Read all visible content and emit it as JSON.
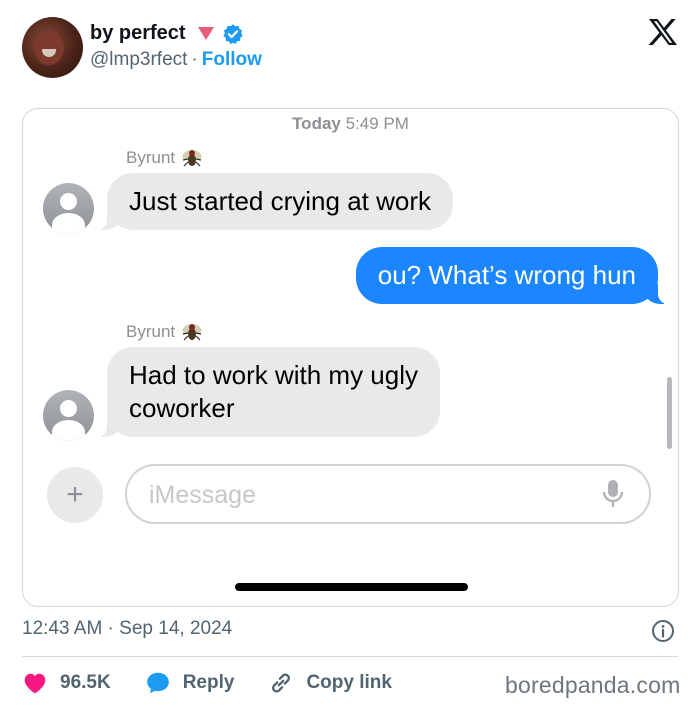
{
  "tweet": {
    "display_name": "by perfect",
    "handle": "@lmp3rfect",
    "separator": "·",
    "follow_label": "Follow",
    "posted_at": "12:43 AM · Sep 14, 2024",
    "actions": {
      "likes_count": "96.5K",
      "reply_label": "Reply",
      "copy_link_label": "Copy link"
    },
    "icons": {
      "platform": "x-logo-icon",
      "verified": "verified-badge-icon",
      "name_emoji": "pink-triangle-icon",
      "like": "heart-icon",
      "reply": "speech-bubble-icon",
      "copy": "link-icon",
      "info": "info-icon"
    },
    "colors": {
      "accent": "#1d9bf0",
      "like": "#f91880",
      "text_secondary": "#536471"
    }
  },
  "conversation": {
    "timestamp_day": "Today",
    "timestamp_time": "5:49 PM",
    "messages": [
      {
        "sender": "Byrunt",
        "direction": "in",
        "text": "Just started crying at work"
      },
      {
        "direction": "out",
        "text": "ou? What’s wrong hun"
      },
      {
        "sender": "Byrunt",
        "direction": "in",
        "lines": [
          "Had to work with my ugly",
          "coworker"
        ]
      }
    ],
    "sender_emoji": "fly-icon",
    "input_placeholder": "iMessage",
    "plus_label": "+",
    "colors": {
      "incoming_bubble": "#e9e9eb",
      "outgoing_bubble": "#1b86ff"
    }
  },
  "watermark": "boredpanda.com"
}
